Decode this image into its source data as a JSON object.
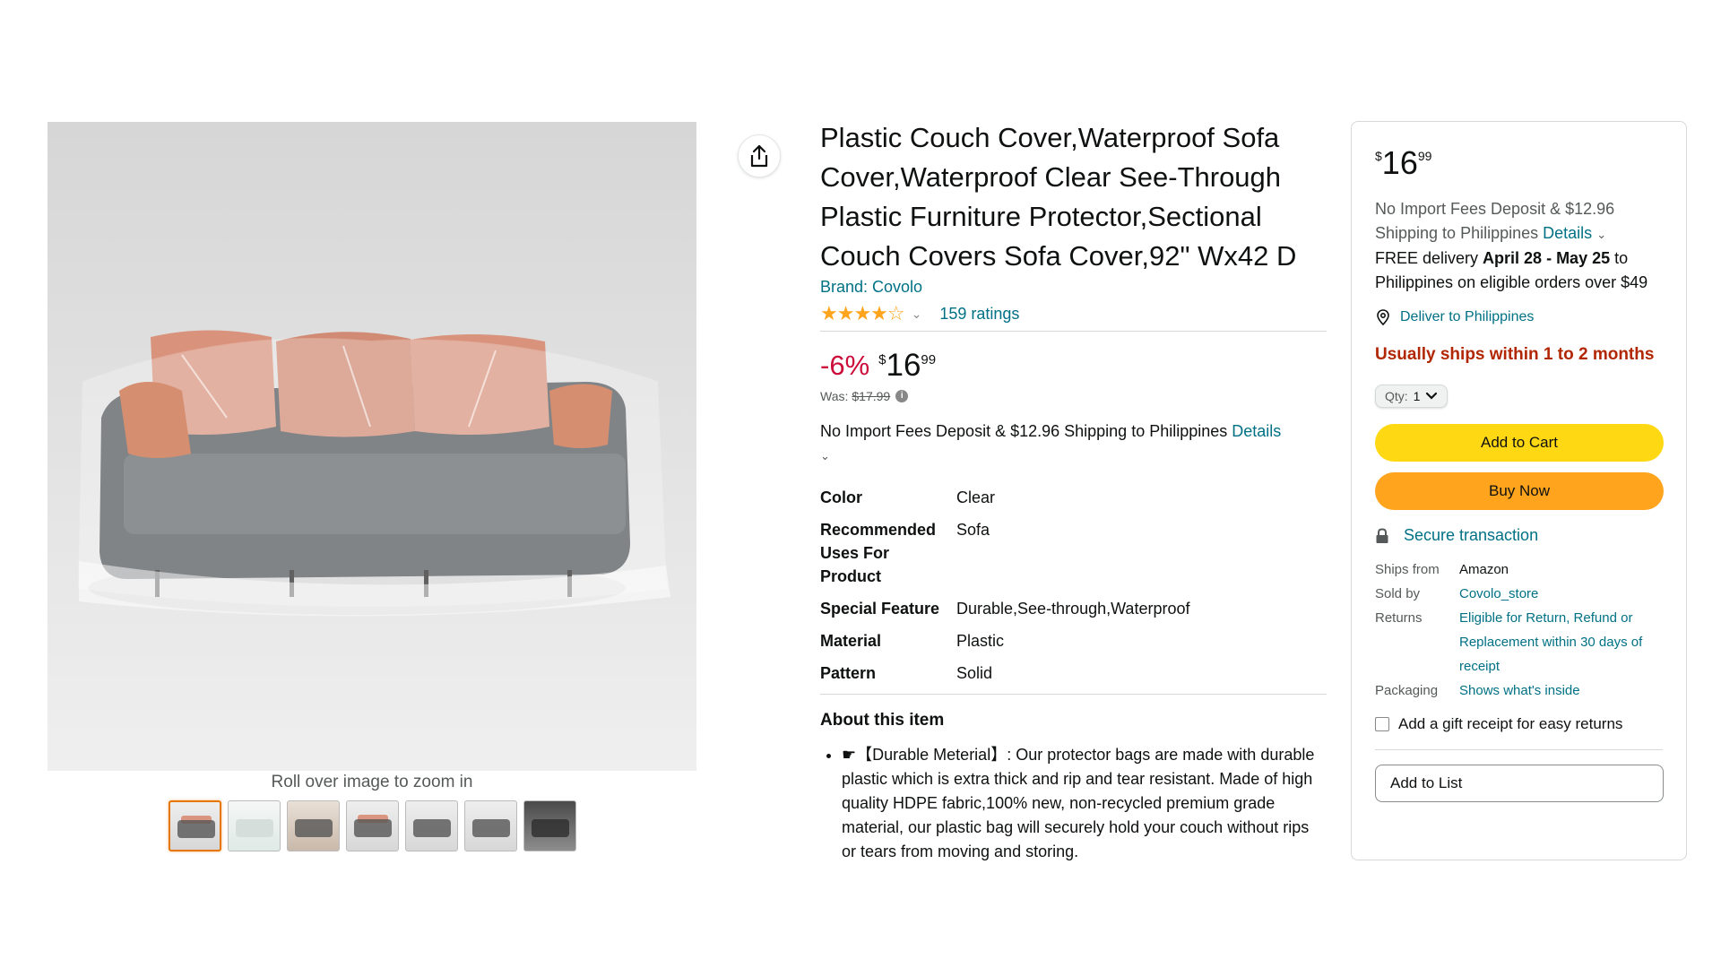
{
  "gallery": {
    "zoom_hint": "Roll over image to zoom in",
    "thumbnail_count": 7
  },
  "share": {
    "icon": "share-icon"
  },
  "product": {
    "title": "Plastic Couch Cover,Waterproof Sofa Cover,Waterproof Clear See-Through Plastic Furniture Protector,Sectional Couch Covers Sofa Cover,92\" Wx42 D",
    "brand": "Brand: Covolo",
    "rating_stars": 4,
    "ratings_count": "159 ratings",
    "discount": "-6%",
    "price": {
      "symbol": "$",
      "whole": "16",
      "fraction": "99"
    },
    "was_label": "Was:",
    "was_price": "$17.99",
    "import_fees": "No Import Fees Deposit & $12.96 Shipping to Philippines",
    "details_link": "Details",
    "specs": [
      {
        "key": "Color",
        "value": "Clear"
      },
      {
        "key": "Recommended Uses For Product",
        "value": "Sofa"
      },
      {
        "key": "Special Feature",
        "value": "Durable,See-through,Waterproof"
      },
      {
        "key": "Material",
        "value": "Plastic"
      },
      {
        "key": "Pattern",
        "value": "Solid"
      }
    ],
    "about_title": "About this item",
    "bullets": [
      "☛【Durable Meterial】: Our protector bags are made with durable plastic which is extra thick and rip and tear resistant. Made of high quality HDPE fabric,100% new, non-recycled premium grade material, our plastic bag will securely hold your couch without rips or tears from moving and storing."
    ]
  },
  "buybox": {
    "price": {
      "symbol": "$",
      "whole": "16",
      "fraction": "99"
    },
    "import_fees": "No Import Fees Deposit & $12.96 Shipping to Philippines",
    "details_link": "Details",
    "delivery_prefix": "FREE delivery",
    "delivery_dates": "April 28 - May 25",
    "delivery_suffix": "to Philippines on eligible orders over $49",
    "deliver_to": "Deliver to Philippines",
    "ships_warning": "Usually ships within 1 to 2 months",
    "qty_label": "Qty:",
    "qty_value": "1",
    "add_to_cart": "Add to Cart",
    "buy_now": "Buy Now",
    "secure": "Secure transaction",
    "facts": [
      {
        "key": "Ships from",
        "value": "Amazon",
        "link": false
      },
      {
        "key": "Sold by",
        "value": "Covolo_store",
        "link": true
      },
      {
        "key": "Returns",
        "value": "Eligible for Return, Refund or Replacement within 30 days of receipt",
        "link": true
      },
      {
        "key": "Packaging",
        "value": "Shows what's inside",
        "link": true
      }
    ],
    "gift_receipt": "Add a gift receipt for easy returns",
    "add_to_list": "Add to List"
  },
  "colors": {
    "link": "#007185",
    "discount": "#cc0c39",
    "warning": "#b12704",
    "cart_button": "#ffd814",
    "buy_button": "#ffa41c",
    "star": "#ffa41c"
  }
}
